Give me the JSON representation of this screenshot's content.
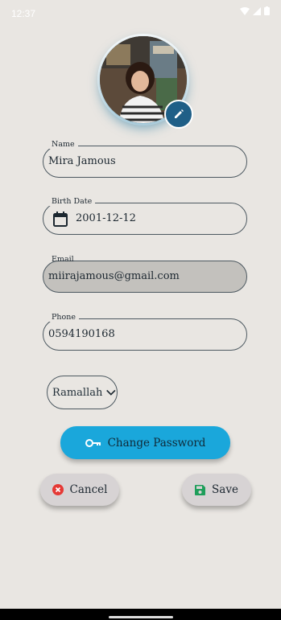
{
  "status_bar": {
    "time": "12:37"
  },
  "profile": {
    "avatar_icon": "profile-photo",
    "edit_icon": "pencil-icon"
  },
  "fields": {
    "name": {
      "label": "Name",
      "value": "Mira Jamous"
    },
    "birth_date": {
      "label": "Birth Date",
      "value": "2001-12-12",
      "icon": "calendar-icon"
    },
    "email": {
      "label": "Email",
      "value": "miirajamous@gmail.com",
      "disabled": true
    },
    "phone": {
      "label": "Phone",
      "value": "0594190168"
    }
  },
  "city_select": {
    "value": "Ramallah",
    "icon": "chevron-down-icon"
  },
  "buttons": {
    "change_password": {
      "label": "Change Password",
      "icon": "key-icon",
      "color": "#1aa7db"
    },
    "cancel": {
      "label": "Cancel",
      "icon": "cancel-circle-icon",
      "icon_color": "#e53935"
    },
    "save": {
      "label": "Save",
      "icon": "floppy-disk-icon",
      "icon_color": "#1e9e5a"
    }
  }
}
